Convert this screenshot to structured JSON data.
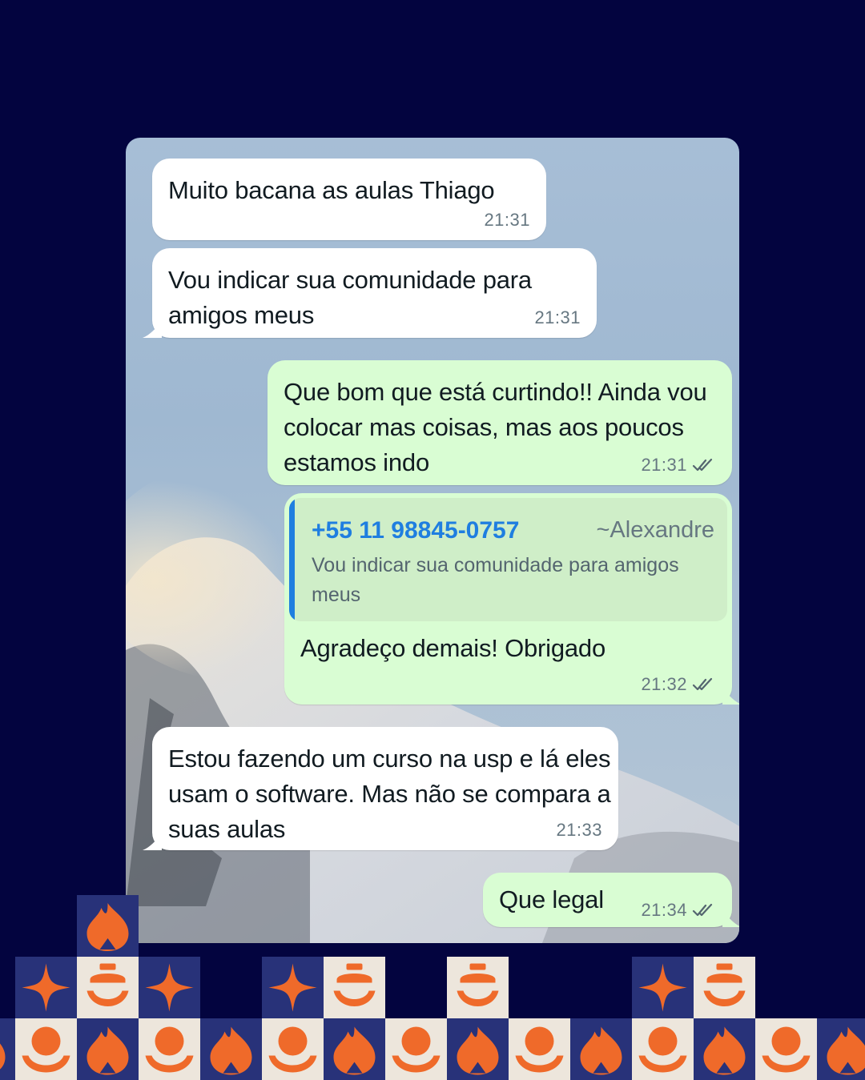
{
  "messages": [
    {
      "direction": "incoming",
      "text": "Muito bacana as aulas Thiago",
      "time": "21:31"
    },
    {
      "direction": "incoming",
      "text": "Vou indicar sua comunidade para amigos meus",
      "time": "21:31"
    },
    {
      "direction": "outgoing",
      "text": "Que bom que está curtindo!! Ainda vou colocar mas coisas, mas aos poucos estamos indo",
      "time": "21:31",
      "status": "read"
    },
    {
      "direction": "outgoing",
      "quoted": {
        "phone": "+55 11 98845-0757",
        "alias": "~Alexandre",
        "text": "Vou indicar sua comunidade para amigos meus"
      },
      "text": "Agradeço demais! Obrigado",
      "time": "21:32",
      "status": "read"
    },
    {
      "direction": "incoming",
      "text": "Estou fazendo um curso na usp e lá eles usam o software. Mas não se compara a suas aulas",
      "time": "21:33"
    },
    {
      "direction": "outgoing",
      "text": "Que legal",
      "time": "21:34",
      "status": "read"
    }
  ],
  "colors": {
    "background": "#03043f",
    "bubble_incoming": "#ffffff",
    "bubble_outgoing": "#d9fdd3",
    "quote_accent": "#1f7ee0",
    "pattern_orange": "#ef6a2a",
    "pattern_navy": "#283279",
    "pattern_cream": "#ede6dc"
  },
  "icons": {
    "read_receipt": "double-check-icon",
    "pattern": [
      "flame-icon",
      "sparkle-icon",
      "lightbulb-smile-icon",
      "sun-moon-icon"
    ]
  }
}
